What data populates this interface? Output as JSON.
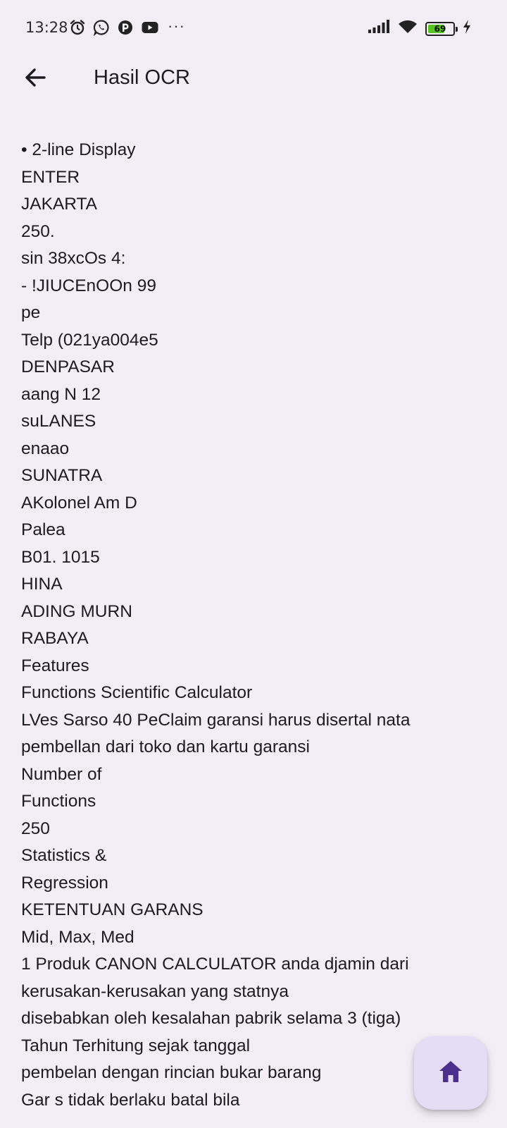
{
  "status_bar": {
    "time": "13:28",
    "battery_level": "69",
    "more_indicator": "···",
    "left_icons": [
      "alarm-icon",
      "whatsapp-icon",
      "app-notification-icon",
      "youtube-icon"
    ],
    "right_icons": [
      "signal-icon",
      "wifi-icon",
      "battery-icon",
      "charging-icon"
    ]
  },
  "app_bar": {
    "title": "Hasil OCR",
    "back_icon": "arrow-left-icon"
  },
  "ocr_lines": [
    "• 2-line Display",
    "ENTER",
    "JAKARTA",
    "250.",
    "sin 38xcOs 4:",
    "- !JIUCEnOOn 99",
    "pe",
    "Telp (021ya004e5",
    "DENPASAR",
    "aang N 12",
    "suLANES",
    "enaao",
    "SUNATRA",
    "AKolonel Am D",
    "Palea",
    "B01. 1015",
    "HINA",
    "ADING MURN",
    "RABAYA",
    "Features",
    "Functions Scientific Calculator",
    "LVes Sarso 40 PeClaim garansi harus disertal nata",
    "pembellan dari toko dan kartu garansi",
    "Number of",
    "Functions",
    "250",
    "Statistics &",
    "Regression",
    "KETENTUAN GARANS",
    "Mid, Max, Med",
    "1 Produk CANON CALCULATOR anda djamin dari",
    "kerusakan-kerusakan yang statnya",
    "disebabkan oleh kesalahan pabrik selama 3 (tiga)",
    "Tahun Terhitung sejak tanggal",
    "pembelan dengan rincian bukar barang",
    "Gar s tidak berlaku batal bila"
  ],
  "fab": {
    "icon": "home-icon",
    "color": "#4a2f8f",
    "background": "#e5dcf6"
  },
  "colors": {
    "background": "#f3eef6",
    "battery_fill": "#58c322",
    "text": "#1c1b1f"
  }
}
